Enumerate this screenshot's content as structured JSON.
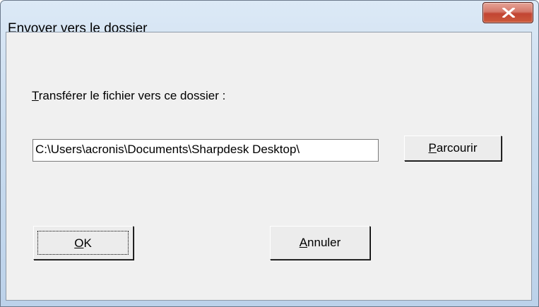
{
  "window": {
    "title": "Envoyer vers le dossier",
    "close_icon": "close-icon"
  },
  "dialog": {
    "label_mnemonic": "T",
    "label_rest": "ransférer le fichier vers ce dossier :",
    "path_value": "C:\\Users\\acronis\\Documents\\Sharpdesk Desktop\\",
    "browse_mnemonic": "P",
    "browse_rest": "arcourir",
    "ok_mnemonic": "O",
    "ok_rest": "K",
    "cancel_mnemonic": "A",
    "cancel_rest": "nnuler"
  }
}
